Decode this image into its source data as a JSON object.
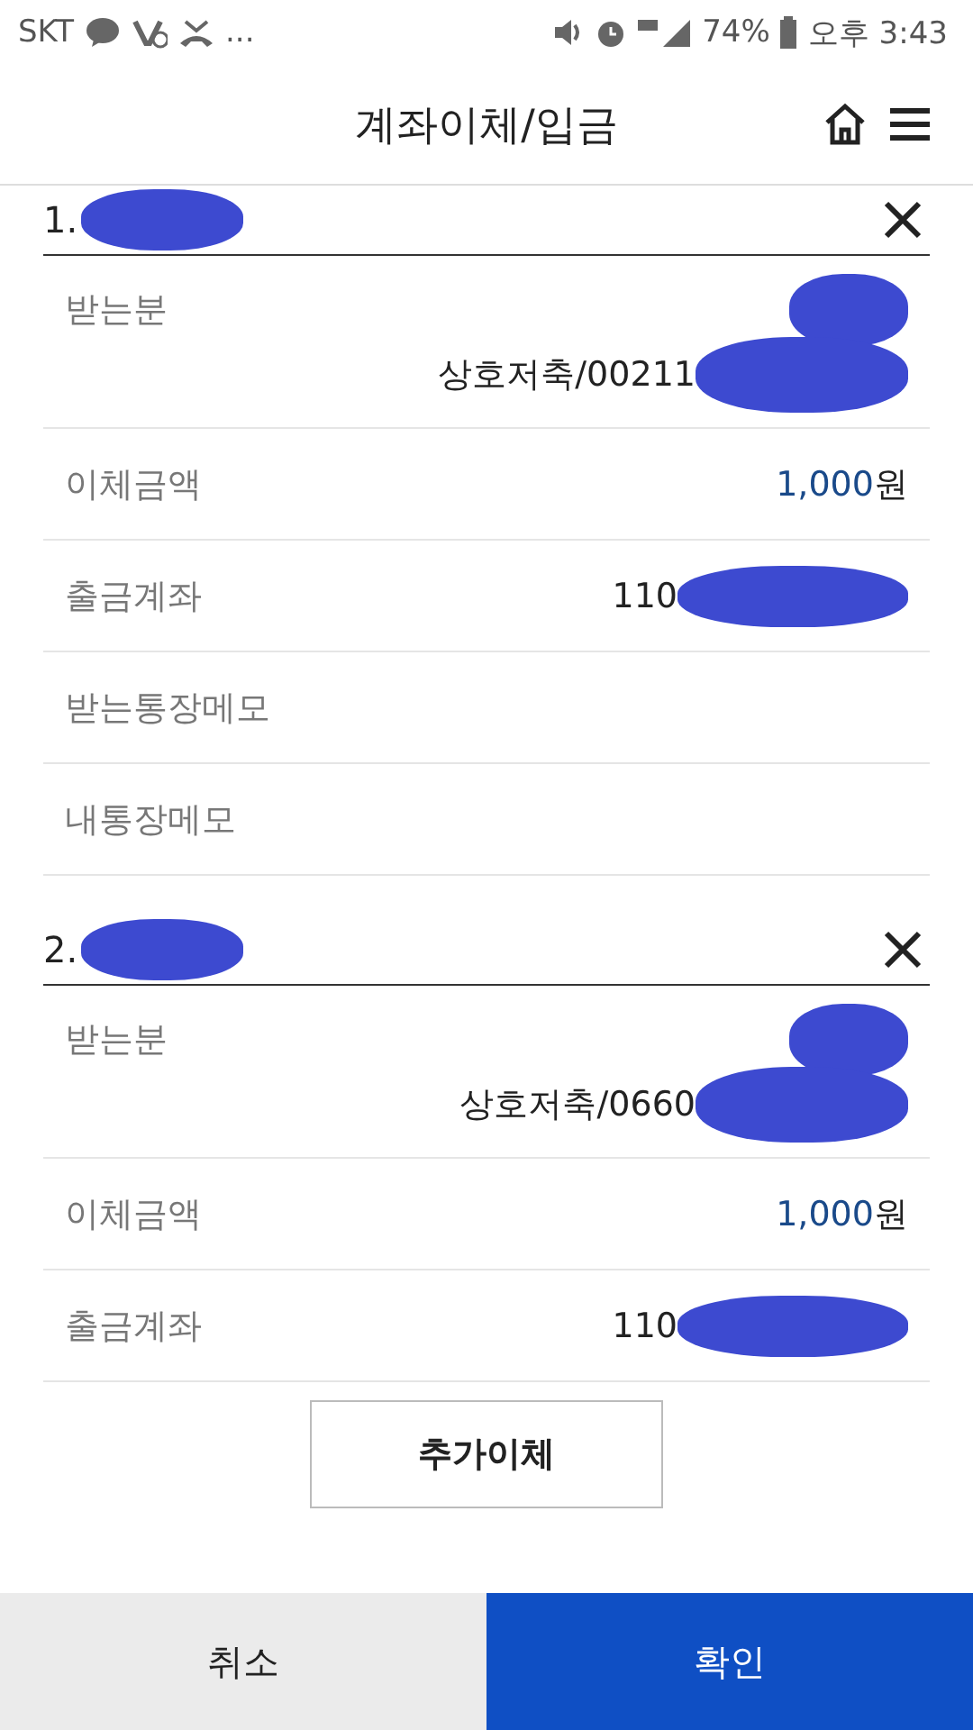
{
  "status_bar": {
    "carrier": "SKT",
    "more": "...",
    "battery": "74%",
    "time": "오후 3:43"
  },
  "header": {
    "title": "계좌이체/입금"
  },
  "transfers": [
    {
      "number": "1.",
      "rows": [
        {
          "kind": "recipient",
          "label": "받는분",
          "value": "상호저축/00211"
        },
        {
          "kind": "amount",
          "label": "이체금액",
          "value": "1,000",
          "unit": "원"
        },
        {
          "kind": "account",
          "label": "출금계좌",
          "value": "110"
        },
        {
          "kind": "memo",
          "label": "받는통장메모"
        },
        {
          "kind": "memo",
          "label": "내통장메모"
        }
      ]
    },
    {
      "number": "2.",
      "rows": [
        {
          "kind": "recipient",
          "label": "받는분",
          "value": "상호저축/0660"
        },
        {
          "kind": "amount",
          "label": "이체금액",
          "value": "1,000",
          "unit": "원"
        },
        {
          "kind": "account",
          "label": "출금계좌",
          "value": "110"
        }
      ]
    }
  ],
  "add_button": "추가이체",
  "buttons": [
    {
      "label": "취소",
      "kind": "cancel"
    },
    {
      "label": "확인",
      "kind": "confirm"
    }
  ]
}
